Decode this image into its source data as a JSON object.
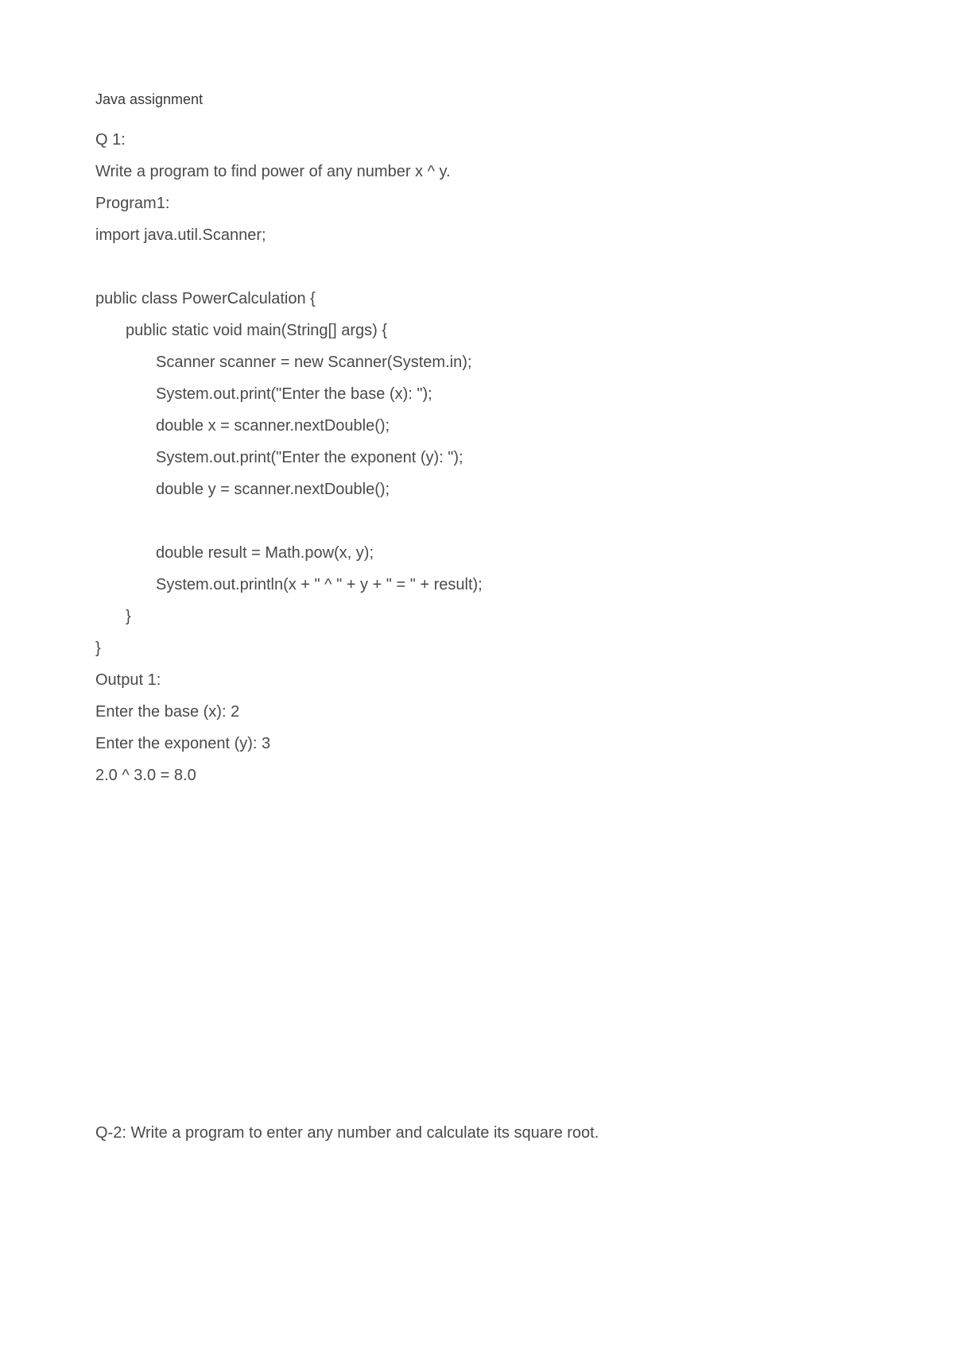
{
  "title": "Java assignment",
  "lines": {
    "q1_label": "Q 1:",
    "q1_desc": "Write a program to find power of any number x ^ y.",
    "program1_label": "Program1:",
    "import_line": "import java.util.Scanner;",
    "class_decl": "public class PowerCalculation {",
    "main_decl": "public static void main(String[] args) {",
    "scanner_line": "Scanner scanner = new Scanner(System.in);",
    "prompt_x": "System.out.print(\"Enter the base (x): \");",
    "read_x": "double x = scanner.nextDouble();",
    "prompt_y": "System.out.print(\"Enter the exponent (y): \");",
    "read_y": "double y = scanner.nextDouble();",
    "result_calc": "double result = Math.pow(x, y);",
    "println": "System.out.println(x + \" ^ \" + y + \" = \" + result);",
    "close_main": "}",
    "close_class": "}",
    "output_label": "Output 1:",
    "output1": "Enter the base (x): 2",
    "output2": "Enter the exponent (y): 3",
    "output3": "2.0 ^ 3.0 = 8.0",
    "q2": "Q-2: Write a program to enter any number and calculate its square root."
  }
}
